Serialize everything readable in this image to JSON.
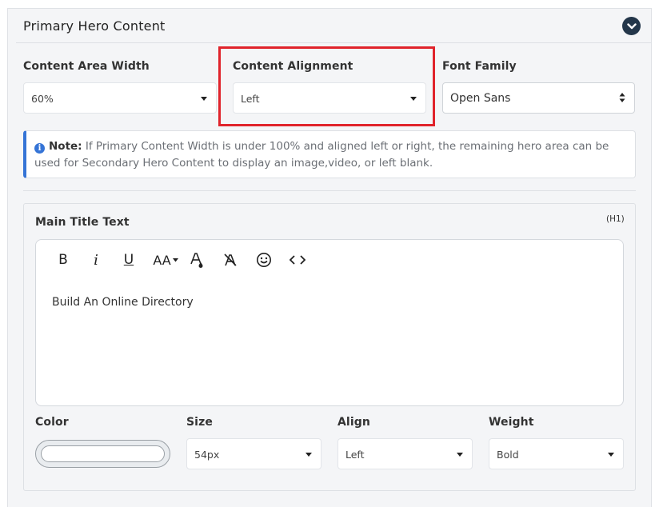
{
  "section": {
    "title": "Primary Hero Content",
    "collapse_icon": "chevron-down-icon"
  },
  "settings": {
    "content_area_width": {
      "label": "Content Area Width",
      "value": "60%"
    },
    "content_alignment": {
      "label": "Content Alignment",
      "value": "Left"
    },
    "font_family": {
      "label": "Font Family",
      "value": "Open Sans"
    }
  },
  "note": {
    "prefix": "Note:",
    "text": "If Primary Content Width is under 100% and aligned left or right, the remaining hero area can be used for Secondary Hero Content to display an image,video, or left blank.",
    "accent_color": "#3574d6"
  },
  "title_block": {
    "label": "Main Title Text",
    "tag": "(H1)",
    "toolbar": {
      "bold": "B",
      "italic": "i",
      "underline": "U",
      "font_size": "AA",
      "font_color_icon": "font-color-icon",
      "clear_format_icon": "clear-format-icon",
      "emoji_icon": "emoji-icon",
      "code_icon": "code-view-icon"
    },
    "content": "Build An Online Directory",
    "color": {
      "label": "Color",
      "value": ""
    },
    "size": {
      "label": "Size",
      "value": "54px"
    },
    "align": {
      "label": "Align",
      "value": "Left"
    },
    "weight": {
      "label": "Weight",
      "value": "Bold"
    }
  },
  "highlight_color": "#e0232b"
}
